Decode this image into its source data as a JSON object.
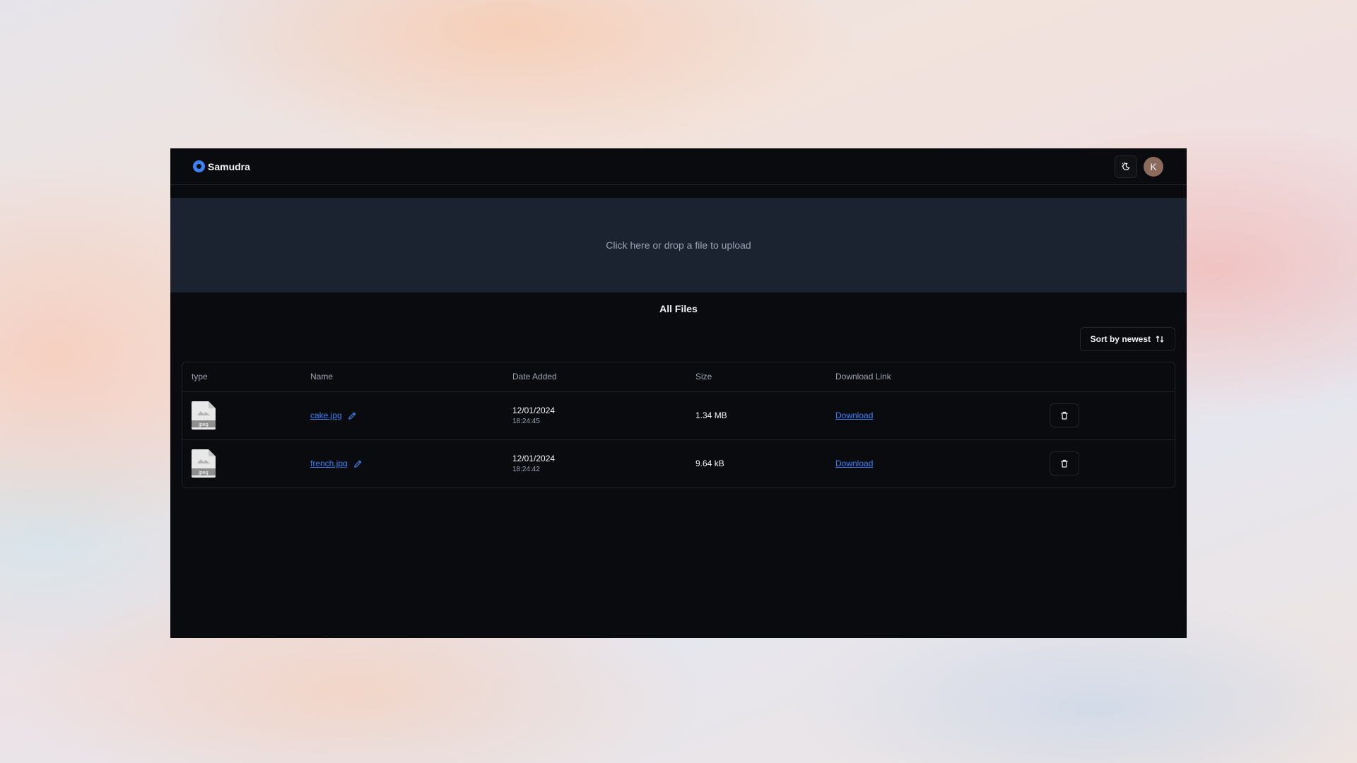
{
  "app": {
    "title": "Samudra",
    "avatar_initial": "K"
  },
  "icons": {
    "logo": "samudra-logo-icon",
    "theme": "theme-toggle-icon",
    "sort": "sort-arrows-icon",
    "edit": "pencil-icon",
    "delete": "trash-icon",
    "file": "jpeg-file-icon"
  },
  "colors": {
    "accent": "#3b82f6",
    "background": "#0a0b0e",
    "dropzone": "#1b2331"
  },
  "upload": {
    "label": "Click here or drop a file to upload"
  },
  "files_section": {
    "title": "All Files",
    "sort_label": "Sort by newest",
    "columns": [
      "type",
      "Name",
      "Date Added",
      "Size",
      "Download Link"
    ],
    "rows": [
      {
        "type": "jpeg",
        "name": "cake.jpg",
        "date": "12/01/2024",
        "time": "18:24:45",
        "size": "1.34 MB",
        "download_label": "Download"
      },
      {
        "type": "jpeg",
        "name": "french.jpg",
        "date": "12/01/2024",
        "time": "18:24:42",
        "size": "9.64 kB",
        "download_label": "Download"
      }
    ]
  }
}
